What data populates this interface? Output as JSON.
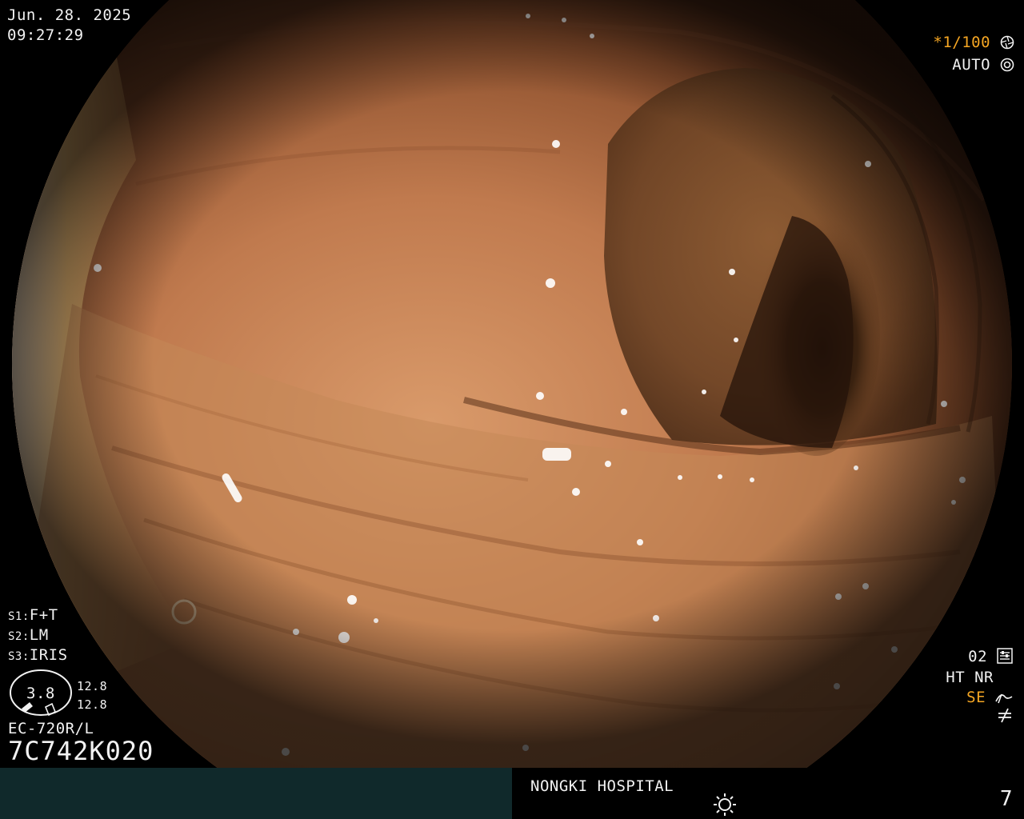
{
  "header": {
    "date": "Jun. 28. 2025",
    "time": "09:27:29"
  },
  "exposure": {
    "shutter_prefix": "*",
    "shutter": "1/100",
    "shutter_icon": "aperture-icon",
    "mode": "AUTO",
    "mode_icon": "iris-icon"
  },
  "softkeys": {
    "s1_key": "S1:",
    "s1_value": "F+T",
    "s2_key": "S2:",
    "s2_value": "LM",
    "s3_key": "S3:",
    "s3_value": "IRIS"
  },
  "gauge": {
    "value": "3.8",
    "upper": "12.8",
    "lower": "12.8"
  },
  "scope": {
    "model": "EC-720R/L",
    "serial": "7C742K020"
  },
  "image_settings": {
    "mode_number": "02",
    "mode_icon": "settings-icon",
    "ht_nr": "HT NR",
    "se": "SE",
    "se_icon": "enhancement-icon",
    "extra_icon": "not-equal-icon"
  },
  "footer": {
    "hospital": "NONGKI HOSPITAL",
    "light_icon": "light-source-icon",
    "page": "7"
  },
  "colors": {
    "accent_orange": "#f5a623",
    "footer_bar": "#10292b"
  }
}
